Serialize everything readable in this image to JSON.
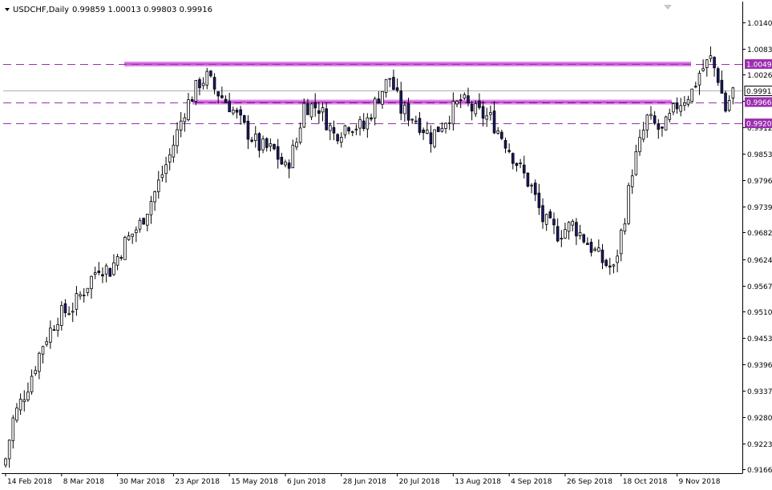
{
  "chart_data": {
    "type": "candlestick",
    "title": "USDCHF,Daily",
    "ohlc_label": "0.99859 1.00013 0.99803 0.99916",
    "ylim": [
      0.9165,
      1.015
    ],
    "y_ticks": [
      1.014,
      1.0083,
      1.0026,
      0.9969,
      0.9912,
      0.98535,
      0.97965,
      0.97395,
      0.96825,
      0.9624,
      0.9567,
      0.951,
      0.9453,
      0.9396,
      0.93375,
      0.92805,
      0.92235,
      0.91665
    ],
    "y_tick_labels": [
      "1.01400",
      "1.00830",
      "1.00260",
      "0.99690",
      "0.99120",
      "0.98535",
      "0.97965",
      "0.97395",
      "0.96825",
      "0.96240",
      "0.95670",
      "0.95100",
      "0.94530",
      "0.93960",
      "0.93375",
      "0.92805",
      "0.92235",
      "0.91665"
    ],
    "x_tick_labels": [
      "14 Feb 2018",
      "8 Mar 2018",
      "30 Mar 2018",
      "23 Apr 2018",
      "15 May 2018",
      "6 Jun 2018",
      "28 Jun 2018",
      "20 Jul 2018",
      "13 Aug 2018",
      "4 Sep 2018",
      "26 Sep 2018",
      "18 Oct 2018",
      "9 Nov 2018"
    ],
    "current_price": 0.99916,
    "current_price_label": "0.99916",
    "levels": [
      {
        "value": 1.00492,
        "label": "1.00492"
      },
      {
        "value": 0.99663,
        "label": "0.99663"
      },
      {
        "value": 0.992,
        "label": "0.99200"
      }
    ],
    "zones": [
      {
        "value": 1.00492
      },
      {
        "value": 0.99663
      }
    ],
    "bull_color": "#ffffff",
    "bear_color": "#1a1a6e",
    "wick_color": "#000000",
    "level_color": "#9b2fae",
    "zone_color": "#d65be0",
    "candle_count": 196,
    "price_path": [
      [
        0,
        0.919
      ],
      [
        2,
        0.9275
      ],
      [
        6,
        0.935
      ],
      [
        10,
        0.944
      ],
      [
        14,
        0.95
      ],
      [
        18,
        0.952
      ],
      [
        22,
        0.957
      ],
      [
        25,
        0.961
      ],
      [
        28,
        0.96
      ],
      [
        32,
        0.966
      ],
      [
        36,
        0.97
      ],
      [
        40,
        0.977
      ],
      [
        44,
        0.985
      ],
      [
        48,
        0.995
      ],
      [
        52,
        1.001
      ],
      [
        54,
        1.002
      ],
      [
        56,
        0.9995
      ],
      [
        60,
        0.996
      ],
      [
        64,
        0.991
      ],
      [
        68,
        0.987
      ],
      [
        72,
        0.986
      ],
      [
        75,
        0.982
      ],
      [
        78,
        0.988
      ],
      [
        80,
        0.996
      ],
      [
        84,
        0.9955
      ],
      [
        88,
        0.9895
      ],
      [
        92,
        0.992
      ],
      [
        96,
        0.991
      ],
      [
        100,
        0.998
      ],
      [
        103,
        1.002
      ],
      [
        106,
        0.995
      ],
      [
        110,
        0.993
      ],
      [
        114,
        0.989
      ],
      [
        118,
        0.993
      ],
      [
        122,
        0.997
      ],
      [
        126,
        0.9945
      ],
      [
        130,
        0.993
      ],
      [
        134,
        0.988
      ],
      [
        138,
        0.982
      ],
      [
        141,
        0.978
      ],
      [
        144,
        0.971
      ],
      [
        148,
        0.968
      ],
      [
        152,
        0.97
      ],
      [
        156,
        0.966
      ],
      [
        160,
        0.962
      ],
      [
        163,
        0.96
      ],
      [
        166,
        0.972
      ],
      [
        168,
        0.982
      ],
      [
        172,
        0.993
      ],
      [
        176,
        0.99
      ],
      [
        180,
        0.996
      ],
      [
        184,
        0.999
      ],
      [
        186,
        1.003
      ],
      [
        189,
        1.006
      ],
      [
        191,
        1.002
      ],
      [
        193,
        0.995
      ],
      [
        195,
        0.99916
      ]
    ]
  }
}
